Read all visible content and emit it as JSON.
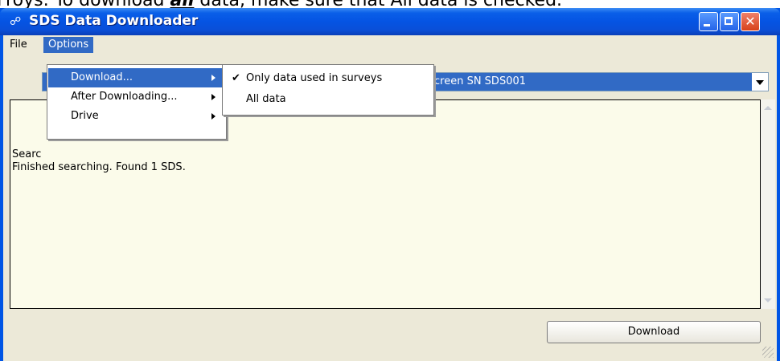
{
  "caption": {
    "before": "Froys: To download ",
    "emph": "all",
    "after": " data, make sure that All data is checked."
  },
  "window": {
    "title": "SDS Data Downloader",
    "app_icon": "sds-icon"
  },
  "menubar": {
    "file_label": "File",
    "options_label": "Options"
  },
  "options_menu": {
    "items": [
      {
        "label": "Download...",
        "has_submenu": true,
        "highlighted": true
      },
      {
        "label": "After Downloading...",
        "has_submenu": true,
        "highlighted": false
      },
      {
        "label": "Drive",
        "has_submenu": true,
        "highlighted": false
      }
    ]
  },
  "download_submenu": {
    "items": [
      {
        "label": "Only data used in surveys",
        "checked": true
      },
      {
        "label": "All data",
        "checked": false
      }
    ]
  },
  "device_combo": {
    "value": "creen SN SDS001"
  },
  "log": {
    "line1": "Searc",
    "line2": "Finished searching.  Found 1 SDS."
  },
  "buttons": {
    "download": "Download"
  },
  "colors": {
    "titlebar": "#0554e3",
    "menu_highlight": "#316ac5",
    "log_background": "#fbfbea",
    "client_background": "#ece9d8"
  }
}
